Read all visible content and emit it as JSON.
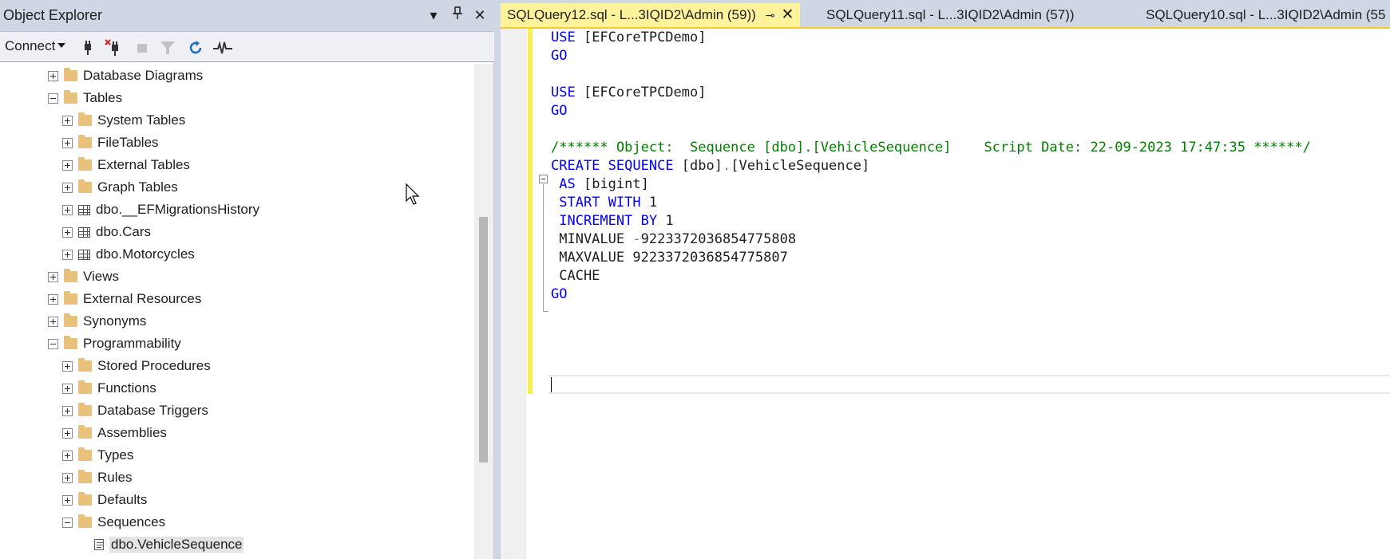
{
  "object_explorer": {
    "title": "Object Explorer",
    "connect_label": "Connect",
    "tree": [
      {
        "label": "Database Diagrams",
        "icon": "folder-icon",
        "expander": "plus"
      },
      {
        "label": "Tables",
        "icon": "folder-icon",
        "expander": "minus"
      },
      {
        "label": "System Tables",
        "icon": "folder-icon",
        "expander": "plus"
      },
      {
        "label": "FileTables",
        "icon": "folder-icon",
        "expander": "plus"
      },
      {
        "label": "External Tables",
        "icon": "folder-icon",
        "expander": "plus"
      },
      {
        "label": "Graph Tables",
        "icon": "folder-icon",
        "expander": "plus"
      },
      {
        "label": "dbo.__EFMigrationsHistory",
        "icon": "table-icon",
        "expander": "plus"
      },
      {
        "label": "dbo.Cars",
        "icon": "table-icon",
        "expander": "plus"
      },
      {
        "label": "dbo.Motorcycles",
        "icon": "table-icon",
        "expander": "plus"
      },
      {
        "label": "Views",
        "icon": "folder-icon",
        "expander": "plus"
      },
      {
        "label": "External Resources",
        "icon": "folder-icon",
        "expander": "plus"
      },
      {
        "label": "Synonyms",
        "icon": "folder-icon",
        "expander": "plus"
      },
      {
        "label": "Programmability",
        "icon": "folder-icon",
        "expander": "minus"
      },
      {
        "label": "Stored Procedures",
        "icon": "folder-icon",
        "expander": "plus"
      },
      {
        "label": "Functions",
        "icon": "folder-icon",
        "expander": "plus"
      },
      {
        "label": "Database Triggers",
        "icon": "folder-icon",
        "expander": "plus"
      },
      {
        "label": "Assemblies",
        "icon": "folder-icon",
        "expander": "plus"
      },
      {
        "label": "Types",
        "icon": "folder-icon",
        "expander": "plus"
      },
      {
        "label": "Rules",
        "icon": "folder-icon",
        "expander": "plus"
      },
      {
        "label": "Defaults",
        "icon": "folder-icon",
        "expander": "plus"
      },
      {
        "label": "Sequences",
        "icon": "folder-icon",
        "expander": "minus"
      },
      {
        "label": "dbo.VehicleSequence",
        "icon": "sequence-icon",
        "expander": "none",
        "selected": true
      }
    ]
  },
  "tabs": [
    {
      "label": "SQLQuery12.sql - L...3IQID2\\Admin (59))",
      "active": true
    },
    {
      "label": "SQLQuery11.sql - L...3IQID2\\Admin (57))",
      "active": false
    },
    {
      "label": "SQLQuery10.sql - L...3IQID2\\Admin (55",
      "active": false
    }
  ],
  "editor": {
    "lines": [
      "USE [EFCoreTPCDemo]",
      "GO",
      "",
      "USE [EFCoreTPCDemo]",
      "GO",
      "",
      "/****** Object:  Sequence [dbo].[VehicleSequence]    Script Date: 22-09-2023 17:47:35 ******/",
      "CREATE SEQUENCE [dbo].[VehicleSequence]",
      " AS [bigint]",
      " START WITH 1",
      " INCREMENT BY 1",
      " MINVALUE -9223372036854775808",
      " MAXVALUE 9223372036854775807",
      " CACHE",
      "GO"
    ]
  },
  "colors": {
    "keyword": "#0000ff",
    "comment": "#008000",
    "active_tab": "#fff29d",
    "chrome": "#cfd7e4"
  }
}
